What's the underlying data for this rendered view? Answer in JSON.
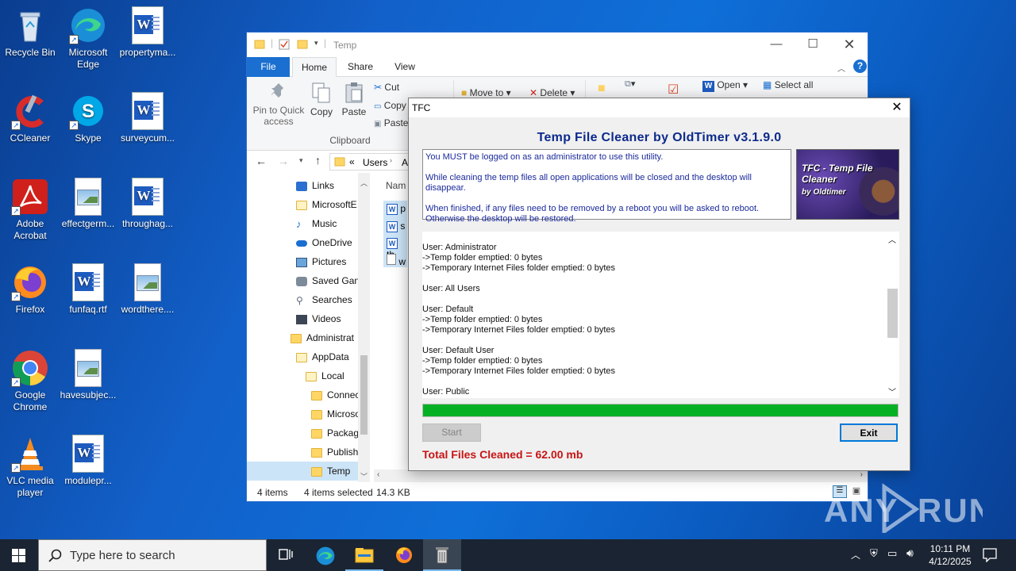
{
  "desktop": {
    "icons": [
      {
        "label": "Recycle Bin",
        "icon": "recycle-bin-icon"
      },
      {
        "label": "Microsoft Edge",
        "icon": "edge-icon"
      },
      {
        "label": "propertyma...",
        "icon": "word-document-icon"
      },
      {
        "label": "CCleaner",
        "icon": "ccleaner-icon"
      },
      {
        "label": "Skype",
        "icon": "skype-icon"
      },
      {
        "label": "surveycum...",
        "icon": "word-document-icon"
      },
      {
        "label": "Adobe Acrobat",
        "icon": "acrobat-icon"
      },
      {
        "label": "effectgerm...",
        "icon": "image-file-icon"
      },
      {
        "label": "throughag...",
        "icon": "word-document-icon"
      },
      {
        "label": "Firefox",
        "icon": "firefox-icon"
      },
      {
        "label": "funfaq.rtf",
        "icon": "word-document-icon"
      },
      {
        "label": "wordthere....",
        "icon": "image-file-icon"
      },
      {
        "label": "Google Chrome",
        "icon": "chrome-icon"
      },
      {
        "label": "havesubjec...",
        "icon": "image-file-icon"
      },
      {
        "label": "VLC media player",
        "icon": "vlc-icon"
      },
      {
        "label": "modulepr...",
        "icon": "word-document-icon"
      }
    ]
  },
  "explorer": {
    "title": "Temp",
    "tabs": [
      "File",
      "Home",
      "Share",
      "View"
    ],
    "ribbon": {
      "pin": "Pin to Quick access",
      "copy": "Copy",
      "paste": "Paste",
      "cut": "Cut",
      "copy_small": "Copy",
      "paste_small": "Paste",
      "clipboard_group": "Clipboard",
      "move_to": "Move to",
      "delete": "Delete",
      "open": "Open",
      "select_all": "Select all"
    },
    "address": {
      "prefix": "«",
      "crumb1": "Users",
      "crumb2": "A"
    },
    "nav": [
      {
        "label": "Links",
        "icon": "link-folder-icon"
      },
      {
        "label": "MicrosoftE",
        "icon": "folder-icon"
      },
      {
        "label": "Music",
        "icon": "music-icon"
      },
      {
        "label": "OneDrive",
        "icon": "onedrive-icon"
      },
      {
        "label": "Pictures",
        "icon": "pictures-icon"
      },
      {
        "label": "Saved Gan",
        "icon": "saved-games-icon"
      },
      {
        "label": "Searches",
        "icon": "search-folder-icon"
      },
      {
        "label": "Videos",
        "icon": "videos-icon"
      },
      {
        "label": "Administrat",
        "icon": "folder-icon"
      },
      {
        "label": "AppData",
        "icon": "folder-icon"
      },
      {
        "label": "Local",
        "icon": "folder-icon"
      },
      {
        "label": "Connec",
        "icon": "folder-icon"
      },
      {
        "label": "Microso",
        "icon": "folder-icon"
      },
      {
        "label": "Packag",
        "icon": "folder-icon"
      },
      {
        "label": "Publish",
        "icon": "folder-icon"
      },
      {
        "label": "Temp",
        "icon": "folder-icon"
      }
    ],
    "content_header": "Nam",
    "files": [
      "p",
      "s",
      "th",
      "w"
    ],
    "status": {
      "items": "4 items",
      "selected": "4 items selected",
      "size": "14.3 KB"
    }
  },
  "tfc": {
    "title": "TFC",
    "heading": "Temp File Cleaner by OldTimer v3.1.9.0",
    "info": [
      "You MUST be logged on as an administrator to use this utility.",
      "While cleaning the temp files all open applications will be closed and the desktop will disappear.",
      "When finished, if any files need to be removed by a reboot you will be asked to reboot.",
      "Otherwise the desktop will be restored."
    ],
    "logo_line1": "TFC - Temp File Cleaner",
    "logo_line2": "by Oldtimer",
    "log": [
      "User: Administrator",
      "->Temp folder emptied: 0 bytes",
      "->Temporary Internet Files folder emptied: 0 bytes",
      "",
      "User: All Users",
      "",
      "User: Default",
      "->Temp folder emptied: 0 bytes",
      "->Temporary Internet Files folder emptied: 0 bytes",
      "",
      "User: Default User",
      "->Temp folder emptied: 0 bytes",
      "->Temporary Internet Files folder emptied: 0 bytes",
      "",
      "User: Public"
    ],
    "progress": 1.0,
    "progress_color": "#06b025",
    "start_label": "Start",
    "exit_label": "Exit",
    "total": "Total Files Cleaned = 62.00 mb"
  },
  "taskbar": {
    "search_placeholder": "Type here to search",
    "apps": [
      "task-view-icon",
      "edge-icon",
      "file-explorer-icon",
      "firefox-icon",
      "tfc-icon"
    ],
    "time": "10:11 PM",
    "date": "4/12/2025"
  },
  "watermark": "ANY RUN"
}
